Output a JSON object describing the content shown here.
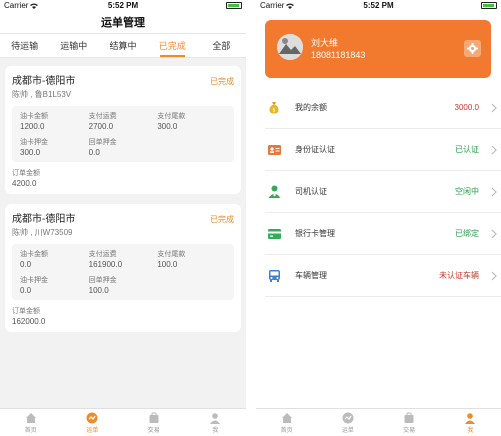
{
  "left": {
    "status": {
      "carrier": "Carrier",
      "time": "5:52 PM"
    },
    "title": "运单管理",
    "tabs": [
      "待运输",
      "运输中",
      "结算中",
      "已完成",
      "全部"
    ],
    "orders": [
      {
        "route": "成都市-德阳市",
        "status": "已完成",
        "driver": "陈帅 , 鲁B1L53V",
        "fields": [
          {
            "label": "油卡金额",
            "value": "1200.0"
          },
          {
            "label": "支付运费",
            "value": "2700.0"
          },
          {
            "label": "支付尾款",
            "value": "300.0"
          },
          {
            "label": "油卡押金",
            "value": "300.0"
          },
          {
            "label": "回单押金",
            "value": "0.0"
          }
        ],
        "total_label": "订单金额",
        "total_value": "4200.0"
      },
      {
        "route": "成都市-德阳市",
        "status": "已完成",
        "driver": "陈帅 , 川W73509",
        "fields": [
          {
            "label": "油卡金额",
            "value": "0.0"
          },
          {
            "label": "支付运费",
            "value": "161900.0"
          },
          {
            "label": "支付尾款",
            "value": "100.0"
          },
          {
            "label": "油卡押金",
            "value": "0.0"
          },
          {
            "label": "回单押金",
            "value": "100.0"
          }
        ],
        "total_label": "订单金额",
        "total_value": "162000.0"
      }
    ],
    "bottom": [
      "首页",
      "运单",
      "交易",
      "我"
    ]
  },
  "right": {
    "status": {
      "carrier": "Carrier",
      "time": "5:52 PM"
    },
    "profile": {
      "name": "刘大维",
      "phone": "18081181843"
    },
    "menu": [
      {
        "icon": "money-bag-icon",
        "label": "我的余额",
        "value": "3000.0",
        "color": "#c0392b"
      },
      {
        "icon": "id-card-icon",
        "label": "身份证认证",
        "value": "已认证",
        "color": "#2a9d4b"
      },
      {
        "icon": "driver-icon",
        "label": "司机认证",
        "value": "空闲中",
        "color": "#2a9d4b"
      },
      {
        "icon": "bank-card-icon",
        "label": "银行卡管理",
        "value": "已绑定",
        "color": "#2a9d4b"
      },
      {
        "icon": "bus-icon",
        "label": "车辆管理",
        "value": "未认证车辆",
        "color": "#c0392b"
      }
    ],
    "bottom": [
      "首页",
      "运单",
      "交易",
      "我"
    ]
  },
  "colors": {
    "accent": "#f08a2b",
    "profile_bg": "#f27a2e"
  }
}
